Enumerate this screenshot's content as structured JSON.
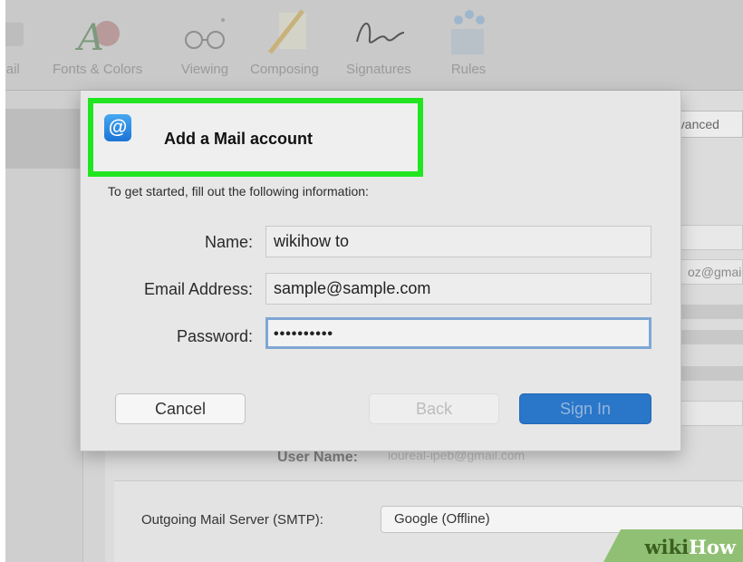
{
  "toolbar": {
    "items": [
      {
        "label": "Mail",
        "icon": "mail-icon"
      },
      {
        "label": "Fonts & Colors",
        "icon": "fonts-colors-icon"
      },
      {
        "label": "Viewing",
        "icon": "glasses-icon"
      },
      {
        "label": "Composing",
        "icon": "pencil-icon"
      },
      {
        "label": "Signatures",
        "icon": "signature-icon"
      },
      {
        "label": "Rules",
        "icon": "rules-icon"
      }
    ]
  },
  "background": {
    "tab_label": "dvanced",
    "email_partial": "oz@gmai",
    "user_name_label": "User Name:",
    "user_name_value": "ioureal-ipeb@gmail.com",
    "smtp_label": "Outgoing Mail Server (SMTP):",
    "smtp_value": "Google (Offline)"
  },
  "dialog": {
    "title": "Add a Mail account",
    "intro": "To get started, fill out the following information:",
    "fields": {
      "name": {
        "label": "Name:",
        "value": "wikihow to"
      },
      "email": {
        "label": "Email Address:",
        "value": "sample@sample.com"
      },
      "password": {
        "label": "Password:",
        "value": "••••••••••"
      }
    },
    "buttons": {
      "cancel": "Cancel",
      "back": "Back",
      "sign_in": "Sign In"
    }
  },
  "watermark": {
    "part1": "wiki",
    "part2": "How"
  },
  "colors": {
    "highlight": "#21e521",
    "accent": "#2a76c8",
    "at_icon": "#1c73d6"
  }
}
